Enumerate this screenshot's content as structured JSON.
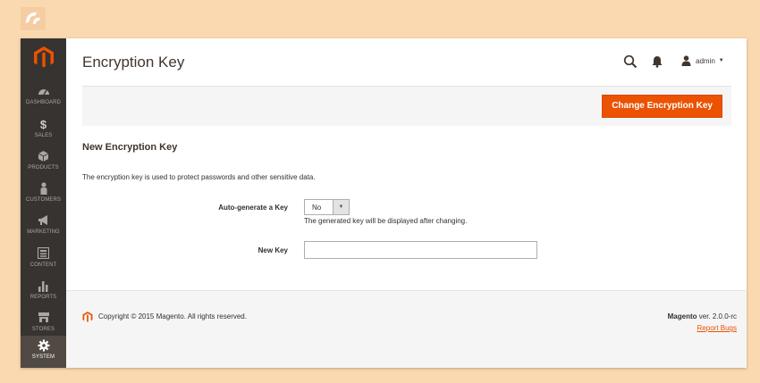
{
  "sidebar": {
    "items": [
      {
        "label": "Dashboard",
        "icon": "dashboard-icon"
      },
      {
        "label": "Sales",
        "icon": "dollar-icon"
      },
      {
        "label": "Products",
        "icon": "cube-icon"
      },
      {
        "label": "Customers",
        "icon": "person-icon"
      },
      {
        "label": "Marketing",
        "icon": "megaphone-icon"
      },
      {
        "label": "Content",
        "icon": "content-grid-icon"
      },
      {
        "label": "Reports",
        "icon": "bar-chart-icon"
      },
      {
        "label": "Stores",
        "icon": "storefront-icon"
      },
      {
        "label": "System",
        "icon": "gear-icon",
        "active": true
      }
    ]
  },
  "header": {
    "title": "Encryption Key",
    "user": "admin"
  },
  "actions": {
    "primary_label": "Change Encryption Key"
  },
  "form": {
    "section_title": "New Encryption Key",
    "description": "The encryption key is used to protect passwords and other sensitive data.",
    "auto_generate": {
      "label": "Auto-generate a Key",
      "value": "No",
      "note": "The generated key will be displayed after changing."
    },
    "new_key": {
      "label": "New Key",
      "value": ""
    }
  },
  "footer": {
    "copyright": "Copyright © 2015 Magento. All rights reserved.",
    "brand": "Magento",
    "version": "ver. 2.0.0-rc",
    "report_bugs": "Report Bugs"
  },
  "colors": {
    "accent": "#eb5202",
    "sidebar_bg": "#373330",
    "page_bg": "#fad9b0"
  }
}
